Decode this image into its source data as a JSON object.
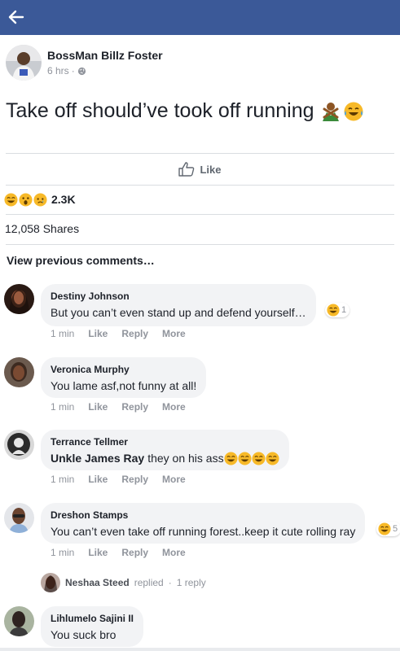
{
  "header": {
    "back_icon": "arrow-left-icon",
    "bar_color": "#3b5998"
  },
  "post": {
    "author": "BossMan Billz Foster",
    "time": "6 hrs",
    "privacy_icon": "globe-icon",
    "text": "Take off should’ve took off running",
    "emojis": [
      "man-gesturing-no-emoji",
      "laughing-tears-emoji"
    ],
    "like_label": "Like",
    "reaction_icons": [
      "laughing-emoji",
      "wow-emoji",
      "sad-emoji"
    ],
    "reactions_count": "2.3K",
    "shares": "12,058 Shares"
  },
  "comments_section": {
    "view_previous": "View previous comments…",
    "action_like": "Like",
    "action_reply": "Reply",
    "action_more": "More",
    "comments": [
      {
        "name": "Destiny Johnson",
        "text": "But you can’t even stand up and defend yourself…",
        "time": "1 min",
        "reaction_count": "1"
      },
      {
        "name": "Veronica Murphy",
        "text": "You lame asf,not funny at all!",
        "time": "1 min"
      },
      {
        "name": "Terrance Tellmer",
        "tag": "Unkle James Ray",
        "text": "they on his ass",
        "time": "1 min"
      },
      {
        "name": "Dreshon Stamps",
        "text": "You can’t even take off running forest..keep it cute rolling ray",
        "time": "1 min",
        "reaction_count": "5"
      },
      {
        "name": "Lihlumelo Sajini II",
        "text": "You suck bro"
      }
    ],
    "reply_preview": {
      "name": "Neshaa Steed",
      "verb": "replied",
      "separator": "·",
      "count": "1 reply"
    }
  },
  "colors": {
    "accent": "#3b5998",
    "muted": "#90949c",
    "bubble": "#f2f3f5",
    "emoji_yellow": "#f7b928"
  }
}
